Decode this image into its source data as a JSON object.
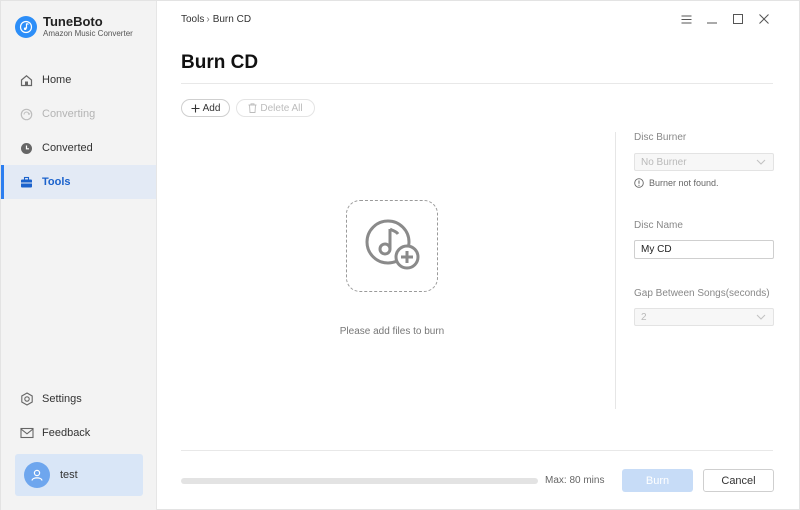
{
  "app": {
    "name": "TuneBoto",
    "subtitle": "Amazon Music Converter"
  },
  "sidebar": {
    "items": [
      {
        "label": "Home",
        "icon": "home-icon",
        "state": "normal"
      },
      {
        "label": "Converting",
        "icon": "converting-icon",
        "state": "disabled"
      },
      {
        "label": "Converted",
        "icon": "clock-icon",
        "state": "normal"
      },
      {
        "label": "Tools",
        "icon": "toolbox-icon",
        "state": "active"
      }
    ],
    "bottom_items": [
      {
        "label": "Settings",
        "icon": "gear-icon"
      },
      {
        "label": "Feedback",
        "icon": "mail-icon"
      }
    ],
    "user": {
      "name": "test",
      "icon": "user-icon"
    }
  },
  "breadcrumb": {
    "parent": "Tools",
    "separator": "›",
    "current": "Burn CD"
  },
  "page": {
    "title": "Burn CD"
  },
  "toolbar": {
    "add_label": "Add",
    "delete_all_label": "Delete All"
  },
  "drop_area": {
    "hint": "Please add files to burn",
    "icon": "music-disc-add-icon"
  },
  "right_panel": {
    "disc_burner": {
      "label": "Disc Burner",
      "selected": "No Burner",
      "warning": "Burner not found."
    },
    "disc_name": {
      "label": "Disc Name",
      "value": "My CD"
    },
    "gap": {
      "label": "Gap Between Songs(seconds)",
      "selected": "2"
    }
  },
  "footer": {
    "progress_fraction": 0,
    "max_label": "Max: 80 mins",
    "burn_label": "Burn",
    "cancel_label": "Cancel"
  },
  "colors": {
    "accent": "#2c7ef0",
    "active_bg": "#e3eaf5",
    "burn_disabled": "#c7dcf7"
  }
}
